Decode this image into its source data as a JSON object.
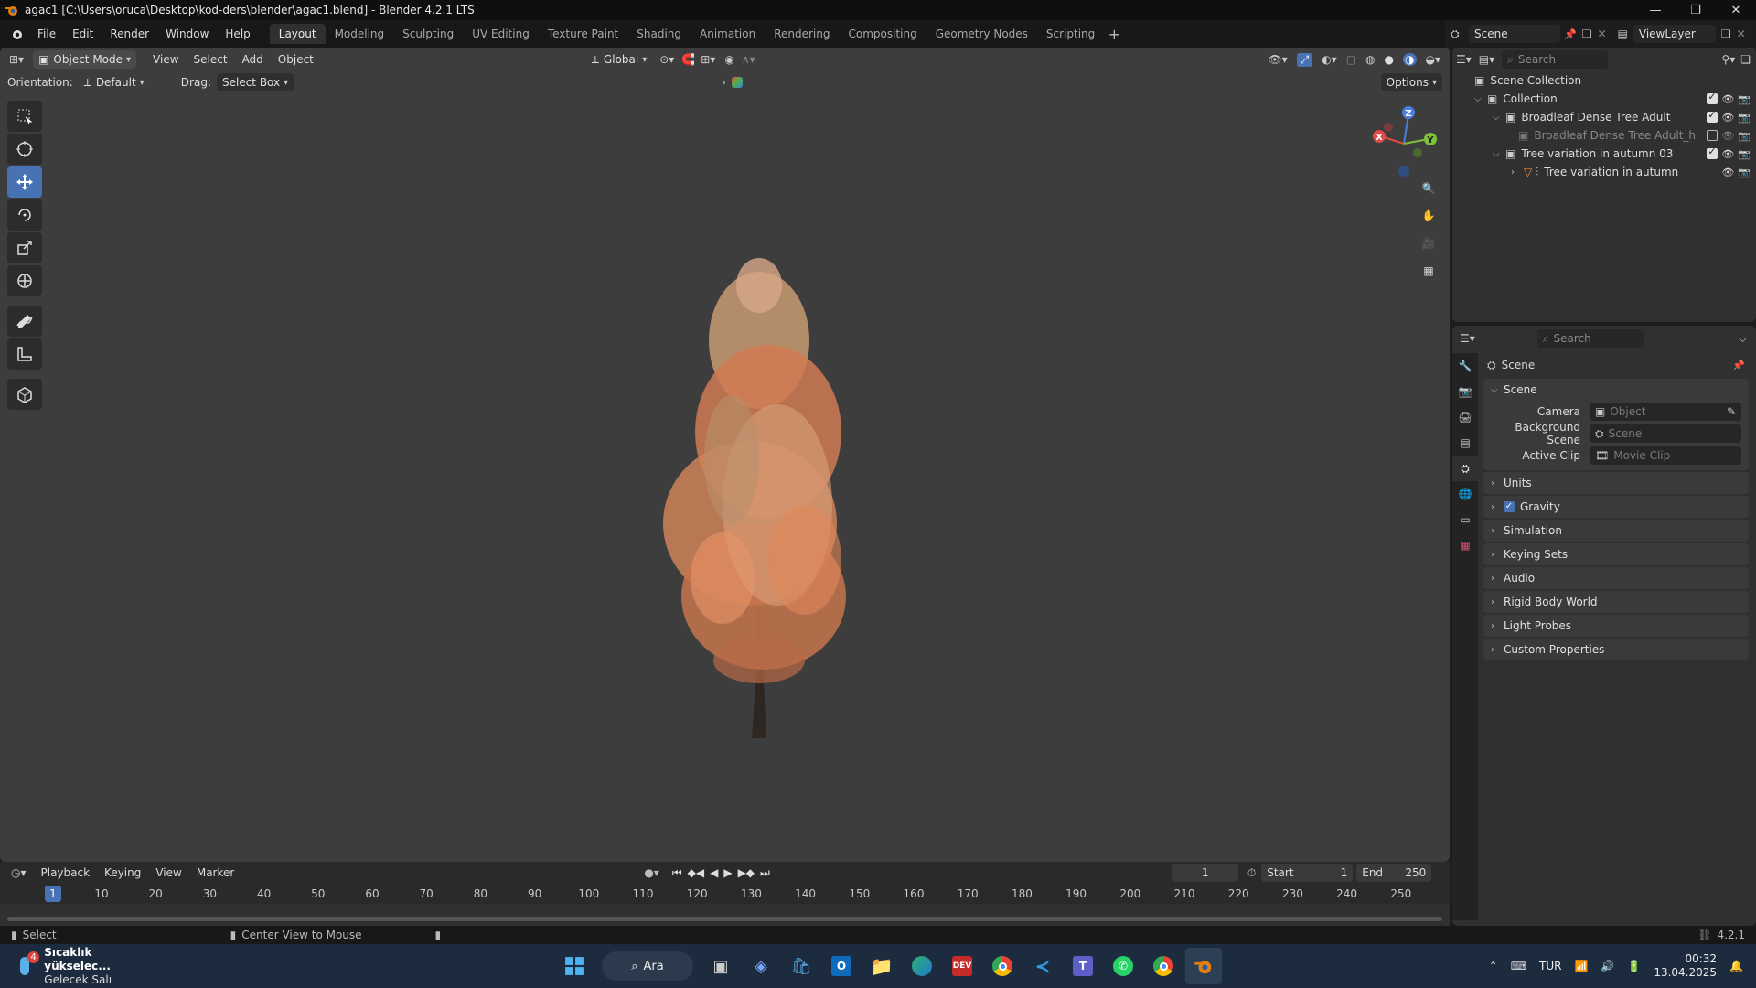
{
  "window": {
    "title": "agac1 [C:\\Users\\oruca\\Desktop\\kod-ders\\blender\\agac1.blend] - Blender 4.2.1 LTS"
  },
  "menu": [
    "File",
    "Edit",
    "Render",
    "Window",
    "Help"
  ],
  "workspaces": [
    "Layout",
    "Modeling",
    "Sculpting",
    "UV Editing",
    "Texture Paint",
    "Shading",
    "Animation",
    "Rendering",
    "Compositing",
    "Geometry Nodes",
    "Scripting"
  ],
  "top_right": {
    "scene": "Scene",
    "view_layer": "ViewLayer"
  },
  "viewport": {
    "mode": "Object Mode",
    "menus": [
      "View",
      "Select",
      "Add",
      "Object"
    ],
    "transform": "Global",
    "orientation_label": "Orientation:",
    "orientation_value": "Default",
    "drag_label": "Drag:",
    "drag_value": "Select Box",
    "options": "Options",
    "gizmo": {
      "x": "X",
      "y": "Y",
      "z": "Z"
    }
  },
  "timeline": {
    "menus": [
      "Playback",
      "Keying",
      "View",
      "Marker"
    ],
    "current_frame": "1",
    "start_label": "Start",
    "start": "1",
    "end_label": "End",
    "end": "250",
    "ruler": [
      "10",
      "20",
      "30",
      "40",
      "50",
      "60",
      "70",
      "80",
      "90",
      "100",
      "110",
      "120",
      "130",
      "140",
      "150",
      "160",
      "170",
      "180",
      "190",
      "200",
      "210",
      "220",
      "230",
      "240",
      "250"
    ],
    "cursor": "1"
  },
  "status": {
    "select": "Select",
    "center": "Center View to Mouse",
    "version": "4.2.1"
  },
  "outliner": {
    "search": "Search",
    "rows": [
      {
        "label": "Scene Collection",
        "indent": 0
      },
      {
        "label": "Collection",
        "indent": 1
      },
      {
        "label": "Broadleaf Dense Tree Adult",
        "indent": 2
      },
      {
        "label": "Broadleaf Dense Tree Adult_h",
        "indent": 3
      },
      {
        "label": "Tree variation in autumn 03",
        "indent": 2
      },
      {
        "label": "Tree variation in autumn",
        "indent": 3
      }
    ]
  },
  "properties": {
    "search": "Search",
    "context": "Scene",
    "section": "Scene",
    "camera_label": "Camera",
    "camera_placeholder": "Object",
    "bg_label": "Background Scene",
    "bg_placeholder": "Scene",
    "clip_label": "Active Clip",
    "clip_placeholder": "Movie Clip",
    "panels": [
      "Units",
      "Gravity",
      "Simulation",
      "Keying Sets",
      "Audio",
      "Rigid Body World",
      "Light Probes",
      "Custom Properties"
    ]
  },
  "taskbar": {
    "weather_title": "Sıcaklık yükselec...",
    "weather_sub": "Gelecek Salı",
    "badge": "4",
    "search": "Ara",
    "lang": "TUR",
    "time": "00:32",
    "date": "13.04.2025"
  },
  "colors": {
    "accent": "#4772b3",
    "viewport_bg": "#3d3d3d"
  }
}
